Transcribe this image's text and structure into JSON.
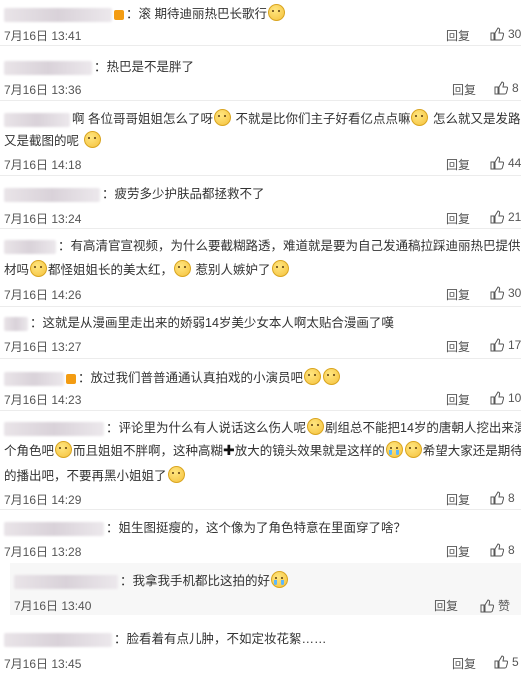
{
  "comments": [
    {
      "text": "：滚 期待迪丽热巴长歌行",
      "time": "7月16日 13:41",
      "reply": "回复",
      "likes": "30"
    },
    {
      "text": "：热巴是不是胖了",
      "time": "7月16日 13:36",
      "reply": "回复",
      "likes": "8"
    },
    {
      "text_a": "啊 各位哥哥姐姐怎么了呀",
      "text_b": "不就是比你们主子好看亿点点嘛",
      "text_c": "怎么就又是发路透",
      "text_d": "又是截图的呢",
      "time": "7月16日 14:18",
      "reply": "回复",
      "likes": "44"
    },
    {
      "text": "：疲劳多少护肤品都拯救不了",
      "time": "7月16日 13:24",
      "reply": "回复",
      "likes": "21"
    },
    {
      "text_a": "：有高清官宣视频，为什么要截糊路透，难道就是要为自己发通稿拉踩迪丽热巴提供素",
      "text_b": "材吗",
      "text_c": "都怪姐姐长的美太红，",
      "text_d": "惹别人嫉妒了",
      "time": "7月16日 14:26",
      "reply": "回复",
      "likes": "30"
    },
    {
      "text": "：这就是从漫画里走出来的娇弱14岁美少女本人啊太贴合漫画了嘆",
      "time": "7月16日 13:27",
      "reply": "回复",
      "likes": "17"
    },
    {
      "text": "：放过我们普普通通认真拍戏的小演员吧",
      "time": "7月16日 14:23",
      "reply": "回复",
      "likes": "10"
    },
    {
      "text_a": "：评论里为什么有人说话这么伤人呢",
      "text_b": "剧组总不能把14岁的唐朝人挖出来演这",
      "text_c": "个角色吧",
      "text_d": "而且姐姐不胖啊，这种高糊",
      "text_e": "放大的镜头效果就是这样的",
      "text_f": "希望大家还是期待剧",
      "text_g": "的播出吧，不要再黑小姐姐了",
      "time": "7月16日 14:29",
      "reply": "回复",
      "likes": "8"
    },
    {
      "text": "：姐生图挺瘦的，这个像为了角色特意在里面穿了啥？",
      "time": "7月16日 13:28",
      "reply": "回复",
      "likes": "8"
    },
    {
      "text": "：我拿我手机都比这拍的好",
      "time": "7月16日 13:40",
      "reply": "回复",
      "likes": "赞"
    },
    {
      "text": "：脸看着有点儿肿，不如定妆花絮……",
      "time": "7月16日 13:45",
      "reply": "回复",
      "likes": "5"
    }
  ],
  "icons": {
    "thumb": "thumbs-up-icon",
    "emoji": "smiley-emoji-icon"
  }
}
